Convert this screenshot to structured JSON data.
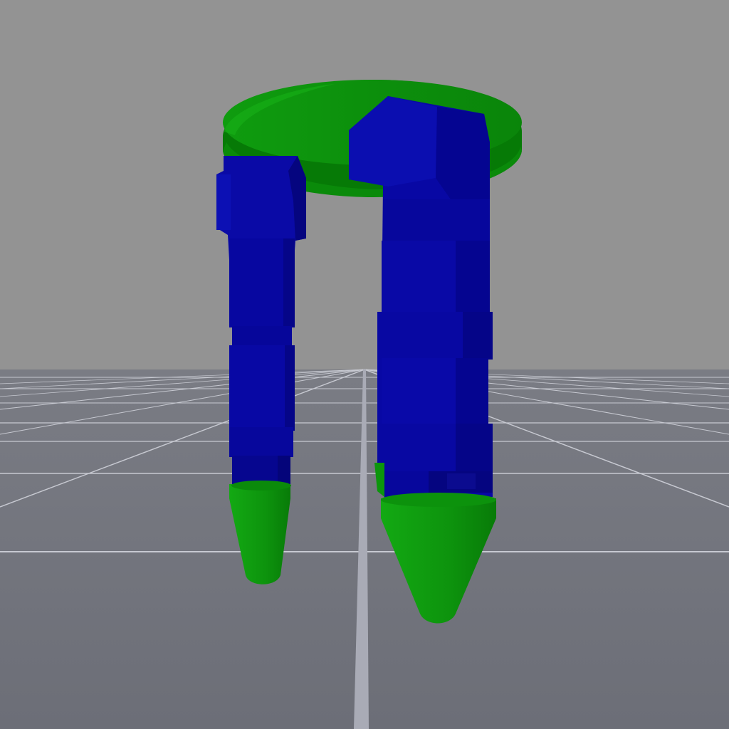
{
  "scene": {
    "description_labels": [],
    "colors": {
      "sky": "#939393",
      "ground": "#6e7079",
      "grid_line": "#c9cbd3",
      "grid_center": "#a6a8b3",
      "leg_blue_light": "#0b0fb0",
      "leg_blue": "#06069a",
      "leg_blue_dark": "#040476",
      "green_light": "#13a713",
      "green": "#0b8e0b",
      "green_dark": "#067006"
    },
    "objects": [
      {
        "name": "tabletop-disc",
        "shape": "ellipse-disc",
        "color": "green"
      },
      {
        "name": "left-leg",
        "shape": "segmented-column",
        "color": "blue"
      },
      {
        "name": "right-leg",
        "shape": "segmented-column",
        "color": "blue"
      },
      {
        "name": "left-foot",
        "shape": "cone",
        "color": "green"
      },
      {
        "name": "right-foot",
        "shape": "cone",
        "color": "green"
      }
    ]
  }
}
